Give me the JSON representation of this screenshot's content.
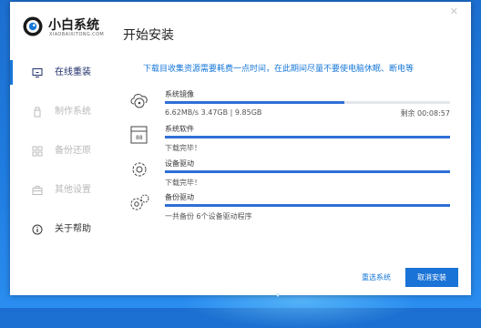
{
  "app": {
    "brand_name": "小白系统",
    "brand_sub": "XIAOBAIXITONG.COM",
    "page_title": "开始安装",
    "close_icon": "close-icon"
  },
  "sidebar": {
    "items": [
      {
        "label": "在线重装",
        "icon": "monitor-icon",
        "state": "active"
      },
      {
        "label": "制作系统",
        "icon": "usb-drive-icon",
        "state": "inactive"
      },
      {
        "label": "备份还原",
        "icon": "grid-icon",
        "state": "inactive"
      },
      {
        "label": "其他设置",
        "icon": "briefcase-icon",
        "state": "inactive"
      },
      {
        "label": "关于帮助",
        "icon": "info-icon",
        "state": "inactive-dark"
      }
    ]
  },
  "main": {
    "notice": "下载目收集资源需要耗费一点时间，在此期间尽量不要使电脑休眠、断电等",
    "tasks": [
      {
        "name": "系统镜像",
        "status": "6.62MB/s 3.47GB | 9.85GB",
        "remaining": "剩余 00:08:57",
        "progress": 0.63,
        "icon": "disc-cloud-icon"
      },
      {
        "name": "系统软件",
        "status": "下载完毕！",
        "remaining": "",
        "progress": 1.0,
        "icon": "software-package-icon"
      },
      {
        "name": "设备驱动",
        "status": "下载完毕！",
        "remaining": "",
        "progress": 1.0,
        "icon": "gear-icon"
      },
      {
        "name": "备份驱动",
        "status": "一共备份 6个设备驱动程序",
        "remaining": "",
        "progress": 1.0,
        "icon": "gears-icon"
      }
    ]
  },
  "footer": {
    "reselect_label": "重选系统",
    "cancel_label": "取消安装"
  },
  "colors": {
    "accent": "#1677d8",
    "progress": "#2e6fd6",
    "desktop": "#1f7ce0"
  }
}
